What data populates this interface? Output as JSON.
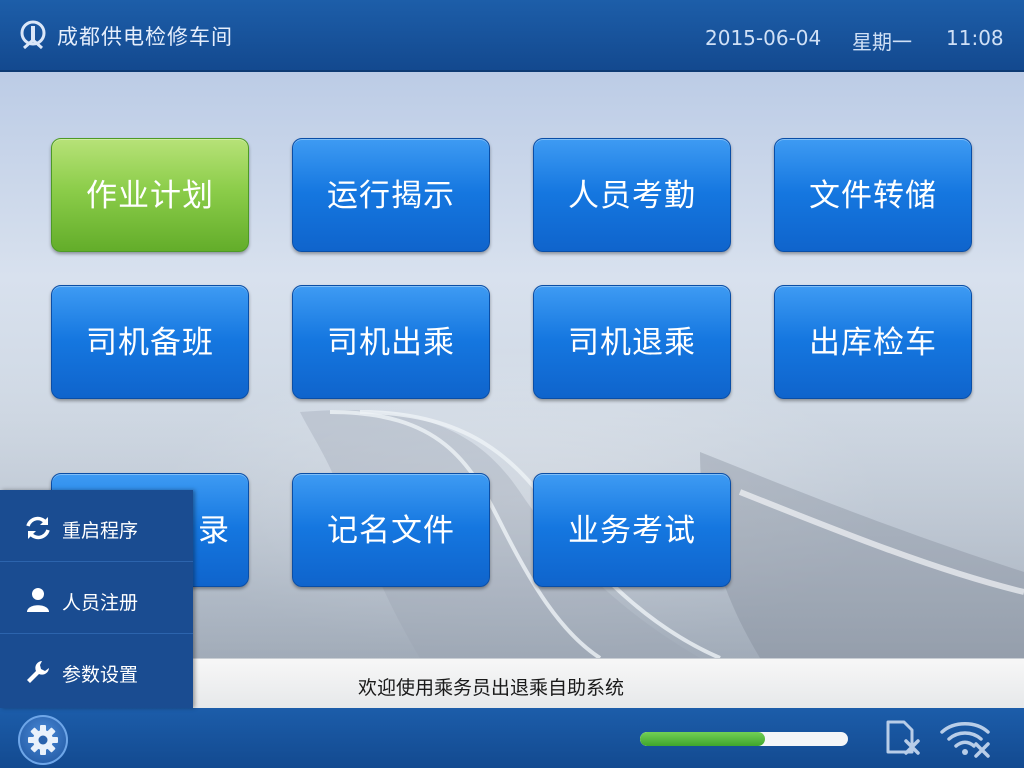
{
  "header": {
    "title": "成都供电检修车间",
    "date": "2015-06-04",
    "weekday": "星期一",
    "time": "11:08",
    "logo_icon": "railway-logo-icon"
  },
  "tiles": [
    {
      "label": "作业计划",
      "style": "green"
    },
    {
      "label": "运行揭示",
      "style": "blue"
    },
    {
      "label": "人员考勤",
      "style": "blue"
    },
    {
      "label": "文件转储",
      "style": "blue"
    },
    {
      "label": "司机备班",
      "style": "blue"
    },
    {
      "label": "司机出乘",
      "style": "blue"
    },
    {
      "label": "司机退乘",
      "style": "blue"
    },
    {
      "label": "出库检车",
      "style": "blue"
    },
    {
      "label": "录",
      "style": "blue"
    },
    {
      "label": "记名文件",
      "style": "blue"
    },
    {
      "label": "业务考试",
      "style": "blue"
    }
  ],
  "side_menu": {
    "items": [
      {
        "label": "重启程序",
        "icon": "refresh-icon"
      },
      {
        "label": "人员注册",
        "icon": "user-icon"
      },
      {
        "label": "参数设置",
        "icon": "wrench-icon"
      }
    ]
  },
  "welcome": {
    "text": "欢迎使用乘务员出退乘自助系统"
  },
  "footer": {
    "settings_icon": "gear-icon",
    "progress_fraction": 0.6,
    "sd_icon": "sd-card-error-icon",
    "wifi_icon": "wifi-disconnected-icon"
  },
  "colors": {
    "header_blue": "#13498f",
    "tile_blue": "#1577e0",
    "tile_green": "#8ccd4a",
    "progress_green": "#4cb536"
  }
}
